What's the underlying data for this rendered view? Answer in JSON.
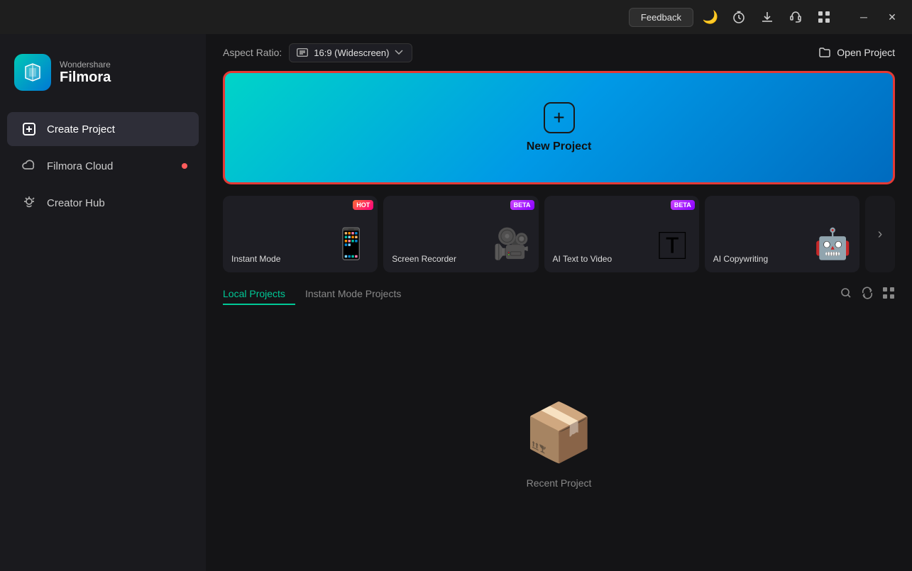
{
  "titlebar": {
    "feedback_label": "Feedback",
    "minimize_label": "—",
    "grid_label": "⊞",
    "close_label": "✕"
  },
  "sidebar": {
    "brand": "Wondershare",
    "product": "Filmora",
    "nav_items": [
      {
        "id": "create-project",
        "label": "Create Project",
        "icon": "➕",
        "active": true,
        "dot": false
      },
      {
        "id": "filmora-cloud",
        "label": "Filmora Cloud",
        "icon": "☁",
        "active": false,
        "dot": true
      },
      {
        "id": "creator-hub",
        "label": "Creator Hub",
        "icon": "💡",
        "active": false,
        "dot": false
      }
    ]
  },
  "content": {
    "aspect_ratio_label": "Aspect Ratio:",
    "aspect_ratio_value": "16:9 (Widescreen)",
    "open_project_label": "Open Project",
    "new_project_label": "New Project",
    "features": [
      {
        "id": "instant-mode",
        "label": "Instant Mode",
        "badge": "HOT",
        "badge_type": "hot",
        "icon": "📱"
      },
      {
        "id": "screen-recorder",
        "label": "Screen Recorder",
        "badge": "BETA",
        "badge_type": "beta",
        "icon": "📹"
      },
      {
        "id": "ai-text-to-video",
        "label": "AI Text to Video",
        "badge": "BETA",
        "badge_type": "beta",
        "icon": "🅃"
      },
      {
        "id": "ai-copywriting",
        "label": "AI Copywriting",
        "badge": "",
        "badge_type": "",
        "icon": "🤖"
      },
      {
        "id": "scroll-more",
        "label": "",
        "badge": "",
        "badge_type": "",
        "icon": "›"
      }
    ],
    "tabs": [
      {
        "id": "local-projects",
        "label": "Local Projects",
        "active": true
      },
      {
        "id": "instant-mode-projects",
        "label": "Instant Mode Projects",
        "active": false
      }
    ],
    "empty_state_label": "Recent Project"
  }
}
